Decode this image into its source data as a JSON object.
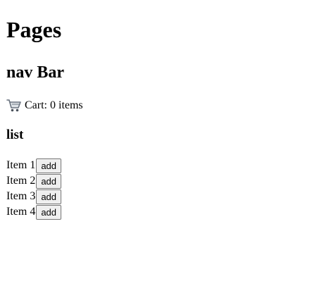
{
  "header": {
    "title": "Pages"
  },
  "nav": {
    "title": "nav Bar",
    "cart": {
      "icon": "shopping-cart-icon",
      "label": "Cart: 0 items"
    }
  },
  "list": {
    "title": "list",
    "items": [
      {
        "label": "Item 1",
        "button": "add"
      },
      {
        "label": "Item 2",
        "button": "add"
      },
      {
        "label": "Item 3",
        "button": "add"
      },
      {
        "label": "Item 4",
        "button": "add"
      }
    ]
  }
}
